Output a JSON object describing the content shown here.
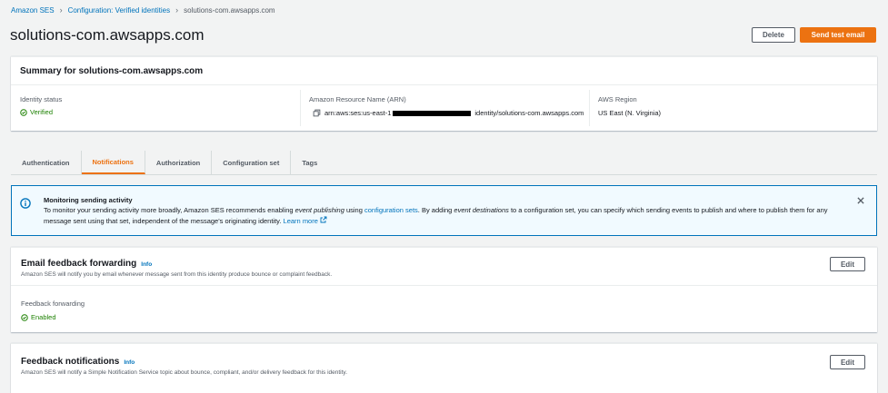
{
  "breadcrumb": {
    "items": [
      "Amazon SES",
      "Configuration: Verified identities",
      "solutions-com.awsapps.com"
    ]
  },
  "page": {
    "title": "solutions-com.awsapps.com",
    "delete_label": "Delete",
    "send_test_label": "Send test email"
  },
  "summary": {
    "title": "Summary for solutions-com.awsapps.com",
    "identity_status_label": "Identity status",
    "identity_status_value": "Verified",
    "arn_label": "Amazon Resource Name (ARN)",
    "arn_prefix": "arn:aws:ses:us-east-1",
    "arn_suffix": "identity/solutions-com.awsapps.com",
    "region_label": "AWS Region",
    "region_value": "US East (N. Virginia)"
  },
  "tabs": [
    {
      "label": "Authentication",
      "active": false
    },
    {
      "label": "Notifications",
      "active": true
    },
    {
      "label": "Authorization",
      "active": false
    },
    {
      "label": "Configuration set",
      "active": false
    },
    {
      "label": "Tags",
      "active": false
    }
  ],
  "alert": {
    "title": "Monitoring sending activity",
    "text_1": "To monitor your sending activity more broadly, Amazon SES recommends enabling ",
    "text_em1": "event publishing",
    "text_2": " using ",
    "link_config_sets": "configuration sets",
    "text_3": ". By adding ",
    "text_em2": "event destinations",
    "text_4": " to a configuration set, you can specify which sending events to publish and where to publish them for any message sent using that set, independent of the message's originating identity. ",
    "learn_more": "Learn more"
  },
  "email_feedback": {
    "title": "Email feedback forwarding",
    "info": "Info",
    "description": "Amazon SES will notify you by email whenever message sent from this identity produce bounce or complaint feedback.",
    "edit_label": "Edit",
    "field_label": "Feedback forwarding",
    "field_value": "Enabled"
  },
  "feedback_notifications": {
    "title": "Feedback notifications",
    "info": "Info",
    "description": "Amazon SES will notify a Simple Notification Service topic about bounce, compliant, and/or delivery feedback for this identity.",
    "edit_label": "Edit"
  },
  "colors": {
    "accent": "#ec7211",
    "link": "#0073bb",
    "success": "#1d8102",
    "info_bg": "#f1faff"
  },
  "icons": {
    "breadcrumb_separator": "chevron-right-icon",
    "status": "check-circle-icon",
    "copy": "copy-icon",
    "alert": "info-circle-icon",
    "dismiss": "close-icon",
    "external": "external-link-icon"
  }
}
